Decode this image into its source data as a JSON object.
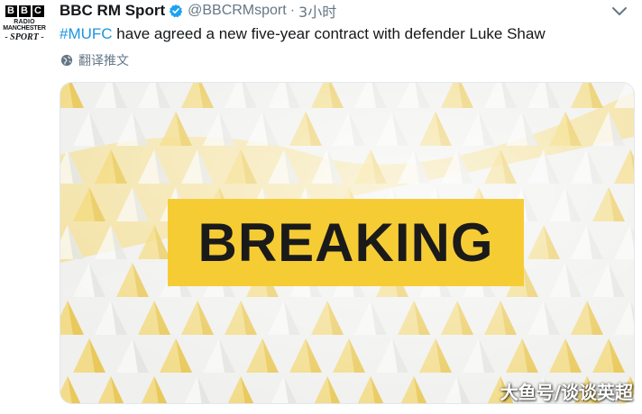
{
  "avatar": {
    "line1": "RADIO",
    "line2": "MANCHESTER",
    "line3": "- SPORT -",
    "bbc_letters": [
      "B",
      "B",
      "C"
    ]
  },
  "tweet": {
    "display_name": "BBC RM Sport",
    "handle": "@BBCRMsport",
    "separator": "·",
    "time": "3小时",
    "hashtag": "#MUFC",
    "text": " have agreed a new five-year contract with defender Luke Shaw",
    "translate_label": "翻译推文"
  },
  "media": {
    "banner_text": "BREAKING",
    "banner_color": "#f6cc35"
  },
  "watermark": "大鱼号/谈谈英超",
  "icons": {
    "verified": "verified-badge-icon",
    "caret": "chevron-down-icon",
    "globe": "globe-icon"
  },
  "colors": {
    "link": "#1b95e0",
    "secondary": "#657786",
    "verified": "#1da1f2"
  }
}
